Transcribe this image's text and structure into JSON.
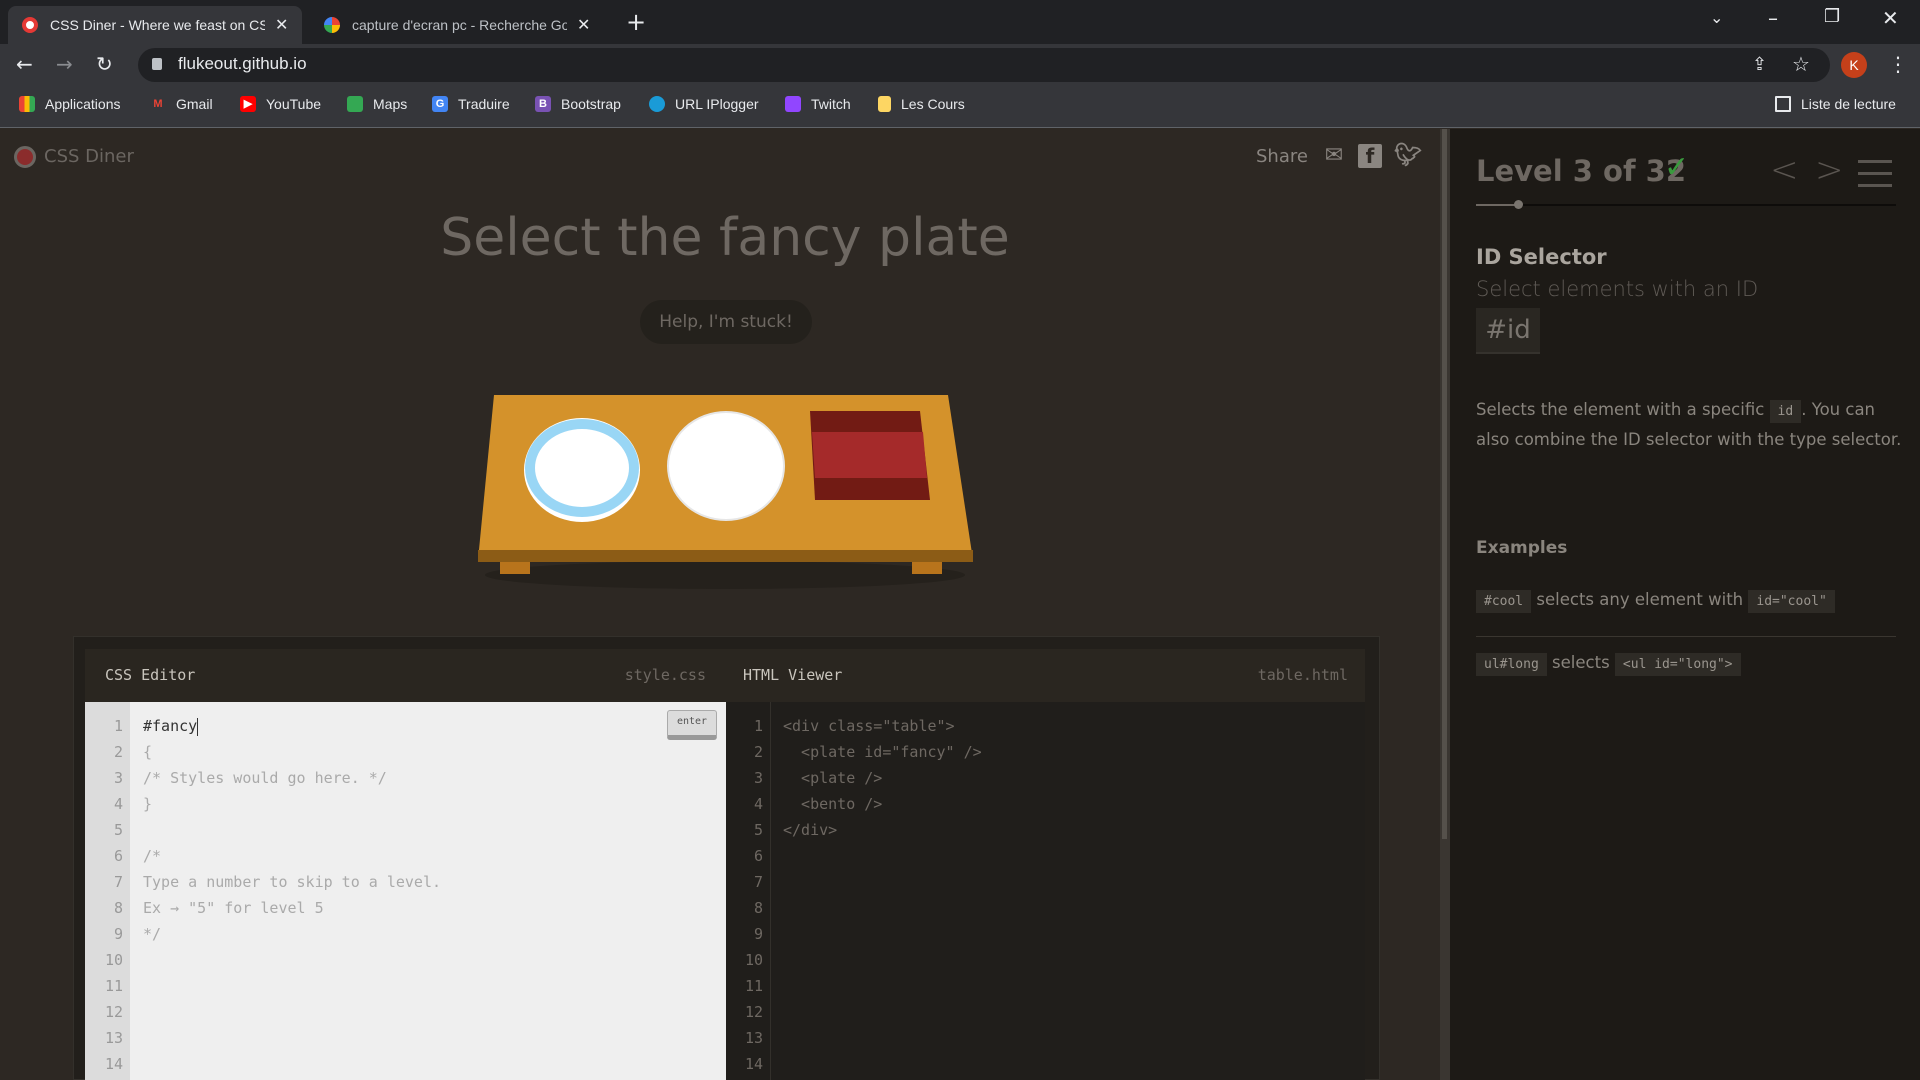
{
  "browser": {
    "tabs": [
      {
        "title": "CSS Diner - Where we feast on CSS",
        "active": true
      },
      {
        "title": "capture d'ecran pc - Recherche Google",
        "active": false
      }
    ],
    "url": "flukeout.github.io",
    "profile_initial": "K",
    "bookmarks": [
      "Applications",
      "Gmail",
      "YouTube",
      "Maps",
      "Traduire",
      "Bootstrap",
      "URL IPlogger",
      "Twitch",
      "Les Cours"
    ],
    "reading_list": "Liste de lecture"
  },
  "header": {
    "logo": "CSS Diner",
    "share": "Share"
  },
  "game": {
    "order": "Select the fancy plate",
    "help": "Help, I'm stuck!",
    "table_items": [
      "fancy plate",
      "plate",
      "bento"
    ]
  },
  "css_editor": {
    "title": "CSS Editor",
    "file": "style.css",
    "enter": "enter",
    "input": "#fancy",
    "lines": [
      "{",
      "/* Styles would go here. */",
      "}",
      "",
      "/*",
      "Type a number to skip to a level.",
      "Ex → \"5\" for level 5",
      "*/"
    ],
    "line_numbers": [
      "1",
      "2",
      "3",
      "4",
      "5",
      "6",
      "7",
      "8",
      "9",
      "10",
      "11",
      "12",
      "13",
      "14"
    ]
  },
  "html_viewer": {
    "title": "HTML Viewer",
    "file": "table.html",
    "lines": [
      "<div class=\"table\">",
      "  <plate id=\"fancy\" />",
      "  <plate />",
      "  <bento />",
      "</div>"
    ]
  },
  "sidebar": {
    "level": "Level 3 of 32",
    "completed": true,
    "progress_fraction": 0.09375,
    "selector_name": "ID Selector",
    "selector_title": "Select elements with an ID",
    "syntax": "#id",
    "desc_1": "Selects the element with a specific ",
    "desc_code": "id",
    "desc_2": ". You can also combine the ID selector with the type selector.",
    "examples_heading": "Examples",
    "examples": [
      {
        "code": "#cool",
        "text": "selects any element with",
        "code2": "id=\"cool\""
      },
      {
        "code": "ul#long",
        "text": "selects",
        "code2": "<ul id=\"long\">"
      }
    ]
  },
  "colors": {
    "check": "#3a9a3e",
    "table": "#d4922b",
    "fancy_rim": "#99d6f5",
    "bento": "#a52a2a",
    "profile": "#c5401a"
  }
}
